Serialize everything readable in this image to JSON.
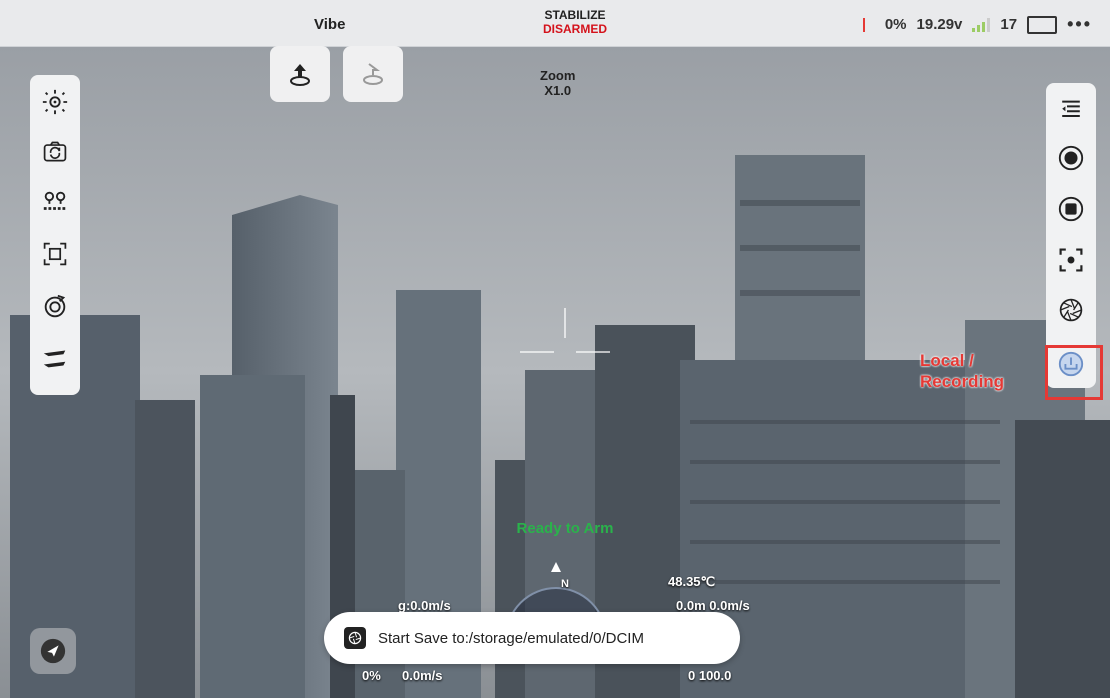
{
  "topbar": {
    "app_name": "Vibe",
    "flight_mode": "STABILIZE",
    "arm_state": "DISARMED",
    "battery_percent": "0%",
    "voltage": "19.29v",
    "satellites": "17",
    "more_label": "•••"
  },
  "zoom": {
    "label": "Zoom",
    "value": "X1.0"
  },
  "annotation": {
    "line1": "Local /",
    "line2": "Recording"
  },
  "status": {
    "ready": "Ready to Arm"
  },
  "hud": {
    "temperature": "48.35℃",
    "speed_g": "g:0.0m/s",
    "speed_xy": "0.0m 0.0m/s",
    "throttle": "0%",
    "vspeed": "0.0m/s",
    "value_right": "0 100.0",
    "compass_n": "N"
  },
  "toast": {
    "message": "Start Save to:/storage/emulated/0/DCIM"
  },
  "colors": {
    "accent_red": "#e53935",
    "ready_green": "#2ab34b",
    "panel": "#f1f2f3"
  },
  "icons": {
    "left": [
      "gimbal-center-icon",
      "camera-switch-icon",
      "waypoint-icon",
      "zoom-frame-icon",
      "orbit-icon",
      "takeoff-land-icon"
    ],
    "right": [
      "menu-collapse-icon",
      "record-icon",
      "stop-icon",
      "focus-icon",
      "aperture-icon",
      "local-recording-icon"
    ]
  }
}
